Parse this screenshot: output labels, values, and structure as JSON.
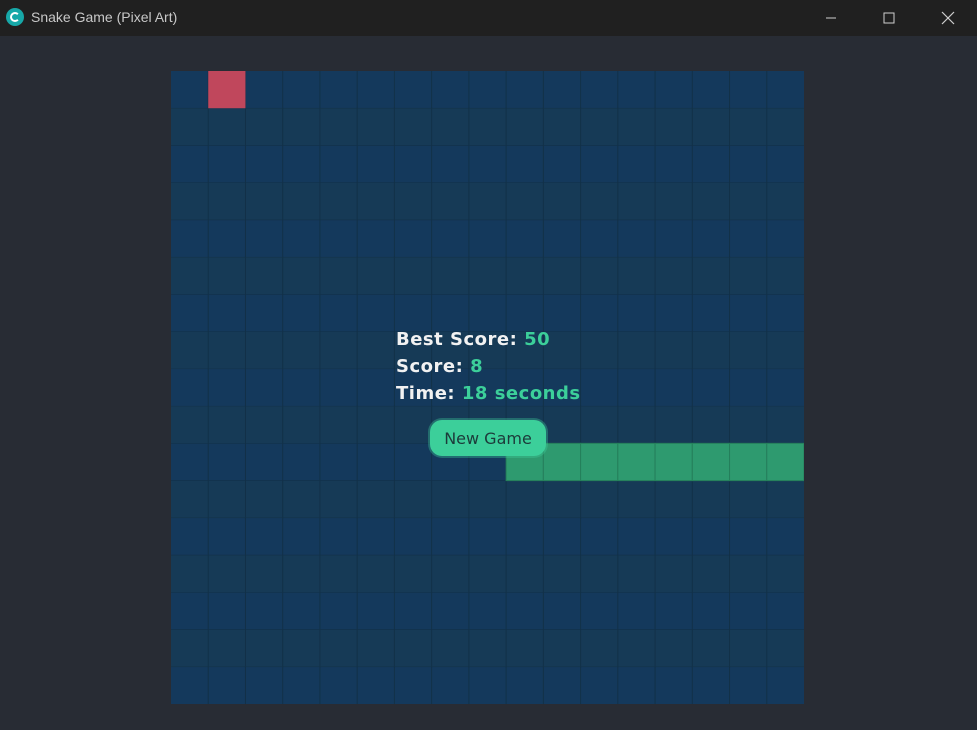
{
  "window": {
    "title": "Snake Game (Pixel Art)",
    "app_icon": "python-icon",
    "controls": [
      "minimize-icon",
      "maximize-icon",
      "close-icon"
    ]
  },
  "game": {
    "grid": {
      "columns": 17,
      "rows": 17
    },
    "food": {
      "col": 1,
      "row": 0
    },
    "snake": [
      {
        "col": 9,
        "row": 10
      },
      {
        "col": 10,
        "row": 10
      },
      {
        "col": 11,
        "row": 10
      },
      {
        "col": 12,
        "row": 10
      },
      {
        "col": 13,
        "row": 10
      },
      {
        "col": 14,
        "row": 10
      },
      {
        "col": 15,
        "row": 10
      },
      {
        "col": 16,
        "row": 10
      }
    ]
  },
  "hud": {
    "best_score_label": "Best Score:",
    "best_score": "50",
    "score_label": "Score:",
    "score": "8",
    "time_label": "Time:",
    "time_value": "18 seconds"
  },
  "buttons": {
    "new_game": "New Game"
  },
  "colors": {
    "background": "#282c34",
    "board_light": "#14395c",
    "board_dark": "#163a56",
    "grid_line": "#123148",
    "snake": "#2e9a6f",
    "snake_border": "#257f5b",
    "food": "#c0475c",
    "accent": "#3ccf9a",
    "titlebar": "#202020"
  }
}
